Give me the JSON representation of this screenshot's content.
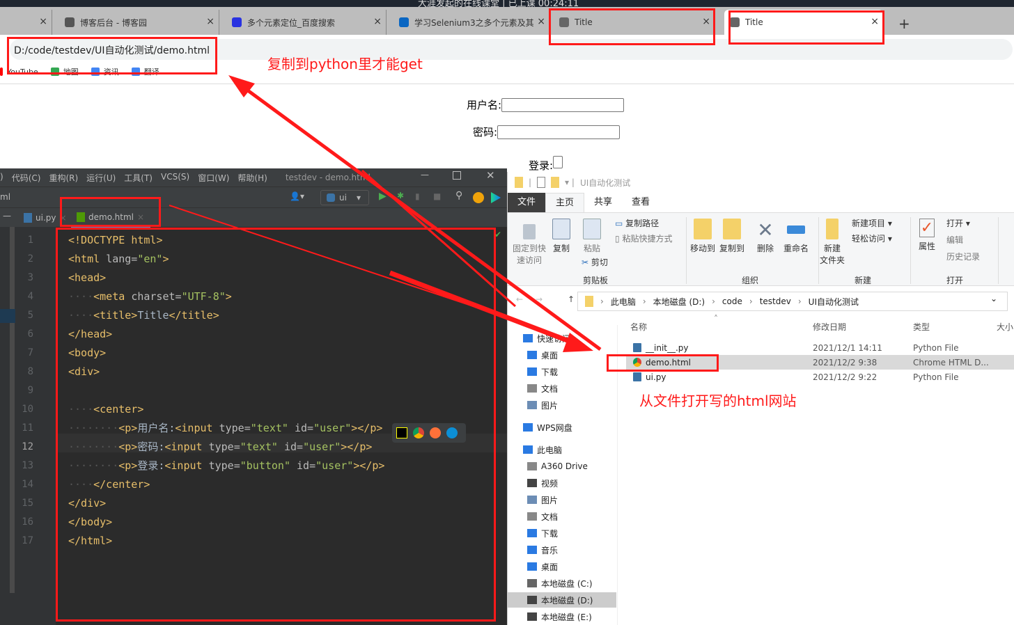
{
  "os_banner": "大涯发起的在线课堂 | 已上课 00:24:11",
  "browser": {
    "tabs": [
      {
        "title": "",
        "close": "×",
        "icon_color": "#bdbdbd"
      },
      {
        "title": "博客后台 - 博客园",
        "close": "×",
        "icon_color": "#555555"
      },
      {
        "title": "多个元素定位_百度搜索",
        "close": "×",
        "icon_color": "#2932e1"
      },
      {
        "title": "学习Selenium3之多个元素及其",
        "close": "×",
        "icon_color": "#0a66c2"
      },
      {
        "title": "Title",
        "close": "×",
        "icon_color": "#666666"
      },
      {
        "title": "Title",
        "close": "×",
        "icon_color": "#666666",
        "active": true
      }
    ],
    "new_tab": "+",
    "address": "D:/code/testdev/UI自动化测试/demo.html",
    "bookmarks": [
      "YouTube",
      "地图",
      "资讯",
      "翻译"
    ]
  },
  "page": {
    "username_label": "用户名:",
    "password_label": "密码:",
    "login_label": "登录:"
  },
  "ide": {
    "menu": [
      ")",
      "代码(C)",
      "重构(R)",
      "运行(U)",
      "工具(T)",
      "VCS(S)",
      "窗口(W)",
      "帮助(H)"
    ],
    "title": "testdev - demo.html",
    "breadcrumb": "ml",
    "run_config": "ui",
    "tabs": [
      {
        "label": "ui.py"
      },
      {
        "label": "demo.html",
        "active": true
      }
    ],
    "current_line": 12,
    "lines": [
      [
        [
          "tag",
          "<!DOCTYPE "
        ],
        [
          "tag",
          "html"
        ],
        [
          "tag",
          ">"
        ]
      ],
      [
        [
          "tag",
          "<html "
        ],
        [
          "attr",
          "lang="
        ],
        [
          "val",
          "\"en\""
        ],
        [
          "tag",
          ">"
        ]
      ],
      [
        [
          "tag",
          "<head>"
        ]
      ],
      [
        [
          "ws",
          "····"
        ],
        [
          "tag",
          "<meta "
        ],
        [
          "attr",
          "charset="
        ],
        [
          "val",
          "\"UTF-8\""
        ],
        [
          "tag",
          ">"
        ]
      ],
      [
        [
          "ws",
          "····"
        ],
        [
          "tag",
          "<title>"
        ],
        [
          "txt",
          "Title"
        ],
        [
          "tag",
          "</title>"
        ]
      ],
      [
        [
          "tag",
          "</head>"
        ]
      ],
      [
        [
          "tag",
          "<body>"
        ]
      ],
      [
        [
          "tag",
          "<div>"
        ]
      ],
      [],
      [
        [
          "ws",
          "····"
        ],
        [
          "tag",
          "<center>"
        ]
      ],
      [
        [
          "ws",
          "········"
        ],
        [
          "tag",
          "<p>"
        ],
        [
          "txt",
          "用户名:"
        ],
        [
          "tag",
          "<input "
        ],
        [
          "attr",
          "type="
        ],
        [
          "val",
          "\"text\" "
        ],
        [
          "attr",
          "id="
        ],
        [
          "val",
          "\"user\""
        ],
        [
          "tag",
          "></p>"
        ]
      ],
      [
        [
          "ws",
          "········"
        ],
        [
          "tag",
          "<p>"
        ],
        [
          "txt",
          "密码:"
        ],
        [
          "tag",
          "<input "
        ],
        [
          "attr",
          "type="
        ],
        [
          "val",
          "\"text\" "
        ],
        [
          "attr",
          "id="
        ],
        [
          "val",
          "\"user\""
        ],
        [
          "tag",
          "></p>"
        ]
      ],
      [
        [
          "ws",
          "········"
        ],
        [
          "tag",
          "<p>"
        ],
        [
          "txt",
          "登录:"
        ],
        [
          "tag",
          "<input "
        ],
        [
          "attr",
          "type="
        ],
        [
          "val",
          "\"button\" "
        ],
        [
          "attr",
          "id="
        ],
        [
          "val",
          "\"user\""
        ],
        [
          "tag",
          "></p>"
        ]
      ],
      [
        [
          "ws",
          "····"
        ],
        [
          "tag",
          "</center>"
        ]
      ],
      [
        [
          "tag",
          "</div>"
        ]
      ],
      [
        [
          "tag",
          "</body>"
        ]
      ],
      [
        [
          "tag",
          "</html>"
        ]
      ]
    ],
    "syntax_colors": {
      "tag": "#e8bf6a",
      "attr": "#bababa",
      "val": "#a5c261",
      "txt": "#a9b7c6"
    }
  },
  "explorer": {
    "title": "UI自动化测试",
    "tabs": [
      "文件",
      "主页",
      "共享",
      "查看"
    ],
    "ribbon": {
      "pin": "固定到快\n速访问",
      "copy": "复制",
      "paste": "粘贴",
      "copy_path": "复制路径",
      "paste_shortcut": "粘贴快捷方式",
      "cut": "剪切",
      "clipboard": "剪贴板",
      "move_to": "移动到",
      "copy_to": "复制到",
      "delete": "删除",
      "rename": "重命名",
      "organize": "组织",
      "new_folder": "新建\n文件夹",
      "new_item": "新建项目 ▾",
      "easy_access": "轻松访问 ▾",
      "new": "新建",
      "properties": "属性",
      "open": "打开 ▾",
      "edit": "编辑",
      "history": "历史记录",
      "open_group": "打开"
    },
    "breadcrumb": [
      "此电脑",
      "本地磁盘 (D:)",
      "code",
      "testdev",
      "UI自动化测试"
    ],
    "sidebar": [
      "快速访问",
      "桌面",
      "下载",
      "文档",
      "图片",
      "WPS网盘",
      "此电脑",
      "A360 Drive",
      "视频",
      "图片",
      "文档",
      "下载",
      "音乐",
      "桌面",
      "本地磁盘 (C:)",
      "本地磁盘 (D:)",
      "本地磁盘 (E:)"
    ],
    "selected_sidebar": "本地磁盘 (D:)",
    "columns": [
      "名称",
      "修改日期",
      "类型",
      "大小"
    ],
    "files": [
      {
        "name": "__init__.py",
        "date": "2021/12/1 14:11",
        "type": "Python File"
      },
      {
        "name": "demo.html",
        "date": "2021/12/2 9:38",
        "type": "Chrome HTML D...",
        "selected": true
      },
      {
        "name": "ui.py",
        "date": "2021/12/2 9:22",
        "type": "Python File"
      }
    ]
  },
  "annotations": {
    "copy_note": "复制到python里才能get",
    "open_note": "从文件打开写的html网站",
    "color": "#ff1a1a"
  }
}
